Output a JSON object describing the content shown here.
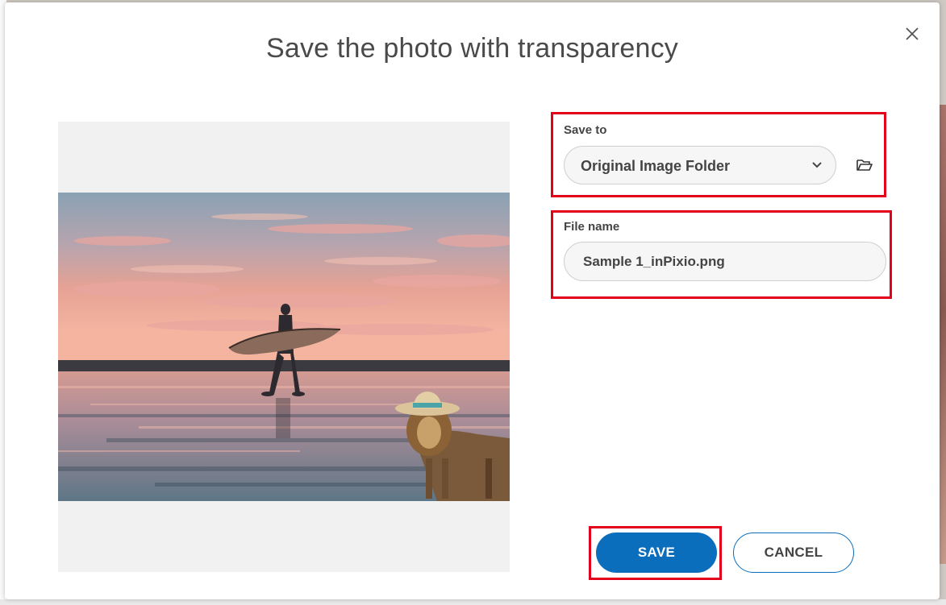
{
  "dialog": {
    "title": "Save the photo with transparency",
    "close_icon": "close-icon"
  },
  "preview": {
    "description_icon": "photo-preview"
  },
  "save_to": {
    "label": "Save to",
    "selected": "Original Image Folder",
    "browse_icon": "folder-open-icon"
  },
  "file_name": {
    "label": "File name",
    "value": "Sample 1_inPixio.png"
  },
  "actions": {
    "save_label": "SAVE",
    "cancel_label": "CANCEL"
  },
  "colors": {
    "accent": "#0a6ebd",
    "highlight": "#e2001a"
  }
}
